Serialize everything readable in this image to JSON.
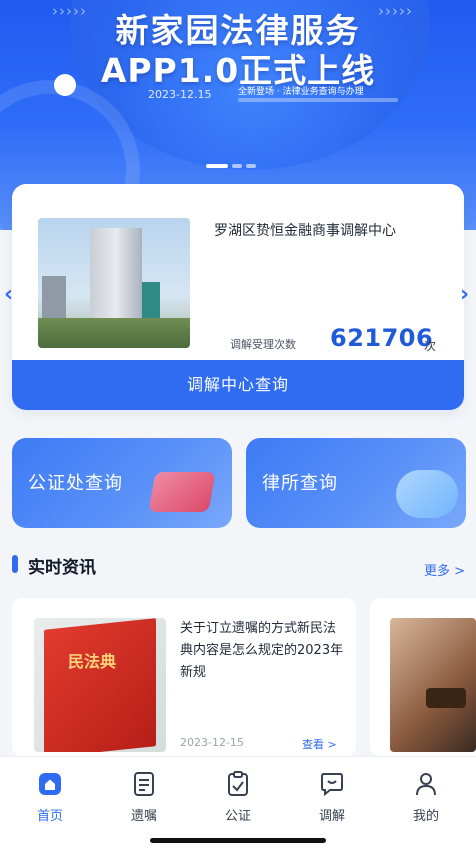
{
  "banner": {
    "title_line1": "新家园法律服务",
    "title_line2": "APP1.0正式上线",
    "date": "2023-12.15",
    "subtitle": "全新登场 · 法律业务查询与办理"
  },
  "center": {
    "name": "罗湖区贽恒金融商事调解中心",
    "count_label": "调解受理次数",
    "count": "621706",
    "count_unit": "次",
    "button": "调解中心查询"
  },
  "queries": [
    {
      "label": "公证处查询"
    },
    {
      "label": "律所查询"
    }
  ],
  "news": {
    "title": "实时资讯",
    "more": "更多 >",
    "items": [
      {
        "text": "关于订立遗嘱的方式新民法典内容是怎么规定的2023年新规",
        "date": "2023-12-15",
        "link": "查看 >",
        "thumb_text": "民法典"
      }
    ]
  },
  "nav": [
    {
      "label": "首页",
      "icon": "home-icon",
      "active": true
    },
    {
      "label": "遗嘱",
      "icon": "document-icon",
      "active": false
    },
    {
      "label": "公证",
      "icon": "clipboard-check-icon",
      "active": false
    },
    {
      "label": "调解",
      "icon": "chat-icon",
      "active": false
    },
    {
      "label": "我的",
      "icon": "user-icon",
      "active": false
    }
  ],
  "colors": {
    "accent": "#2f6cf1",
    "banner": "#1f5bf0",
    "count": "#1f5bd8"
  }
}
